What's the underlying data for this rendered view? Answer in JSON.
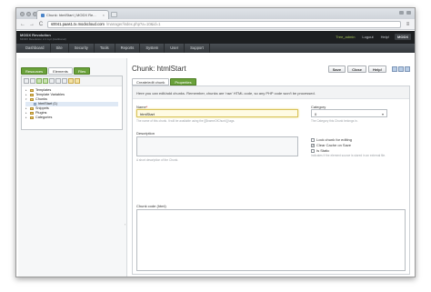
{
  "browser": {
    "tab_title": "Chunk: htmlStart | MODX Re...",
    "tab_close": "×",
    "url_host": "s0041.paas1.tx.modxcloud.com",
    "url_path": "/manager/index.php?a=10&id=1",
    "back": "←",
    "forward": "→",
    "reload": "C",
    "wrench": "≡"
  },
  "header": {
    "brand": "MODX Revolution",
    "version": "MODX Revolution 2.2.4-pl (traditional)",
    "user": "Tree_admin",
    "logout": "Logout",
    "help": "Help!",
    "logo": "MODX"
  },
  "mainnav": [
    "Dashboard",
    "Site",
    "Security",
    "Tools",
    "Reports",
    "System",
    "User",
    "Support"
  ],
  "leftpanel": {
    "tabs": [
      "Resources",
      "Elements",
      "Files"
    ],
    "tree": [
      {
        "label": "Templates",
        "level": 0,
        "icon": "folder"
      },
      {
        "label": "Template Variables",
        "level": 0,
        "icon": "folder"
      },
      {
        "label": "Chunks",
        "level": 0,
        "icon": "folder"
      },
      {
        "label": "htmlStart (1)",
        "level": 1,
        "icon": "chunk"
      },
      {
        "label": "Snippets",
        "level": 0,
        "icon": "folder"
      },
      {
        "label": "Plugins",
        "level": 0,
        "icon": "folder"
      },
      {
        "label": "Categories",
        "level": 0,
        "icon": "folder"
      }
    ]
  },
  "main": {
    "title": "Chunk: htmlStart",
    "actions": {
      "save": "Save",
      "close": "Close",
      "help": "Help!"
    },
    "tabs": [
      "Create/edit chunk",
      "Properties"
    ],
    "intro": "Here you can edit/add chunks. Remember, chunks are 'raw' HTML code, so any PHP code won't be processed.",
    "name_label": "Name",
    "name_required": "*",
    "name_value": "htmlStart",
    "name_help": "The name of this chunk. It will be available using the [[$nameOfChunk]] tags.",
    "category_label": "Category",
    "category_value": "0",
    "category_help": "The Category this Chunk belongs in.",
    "description_label": "Description",
    "description_help": "A short description of the Chunk.",
    "lock_label": "Lock chunk for editing",
    "clear_cache_label": "Clear Cache on Save",
    "is_static_label": "Is Static",
    "is_static_help": "Indicates if the element source is stored in an external file.",
    "code_label": "Chunk code (html)"
  },
  "colors": {
    "accent_green": "#6aa13a",
    "header_dark": "#1d1f21"
  }
}
